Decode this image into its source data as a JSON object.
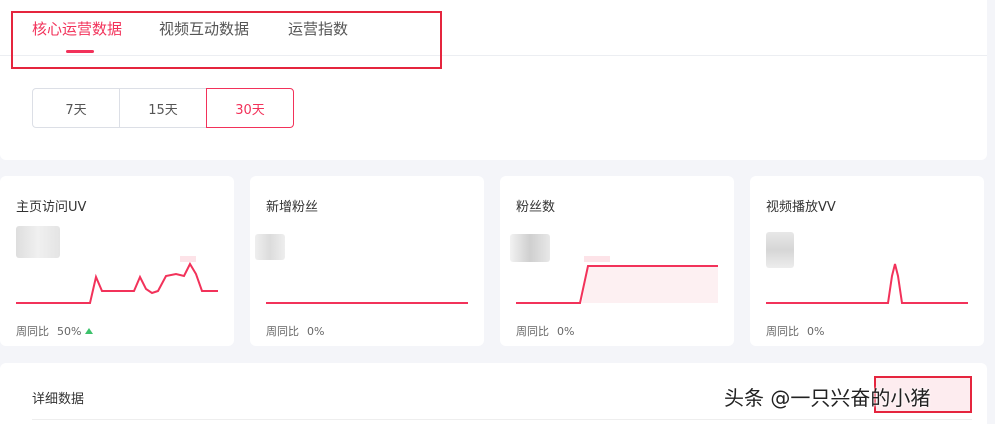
{
  "tabs": [
    {
      "label": "核心运营数据",
      "active": true
    },
    {
      "label": "视频互动数据",
      "active": false
    },
    {
      "label": "运营指数",
      "active": false
    }
  ],
  "range_buttons": [
    {
      "label": "7天",
      "active": false
    },
    {
      "label": "15天",
      "active": false
    },
    {
      "label": "30天",
      "active": true
    }
  ],
  "cards": [
    {
      "title": "主页访问UV",
      "compare_label": "周同比",
      "compare_value": "50%",
      "trend": "up"
    },
    {
      "title": "新增粉丝",
      "compare_label": "周同比",
      "compare_value": "0%"
    },
    {
      "title": "粉丝数",
      "compare_label": "周同比",
      "compare_value": "0%"
    },
    {
      "title": "视频播放VV",
      "compare_label": "周同比",
      "compare_value": "0%"
    }
  ],
  "detail": {
    "title": "详细数据"
  },
  "watermark": "头条 @一只兴奋的小猪",
  "colors": {
    "accent": "#f2325a",
    "highlight_box": "#e5253e",
    "trend_up": "#3cc26b"
  }
}
